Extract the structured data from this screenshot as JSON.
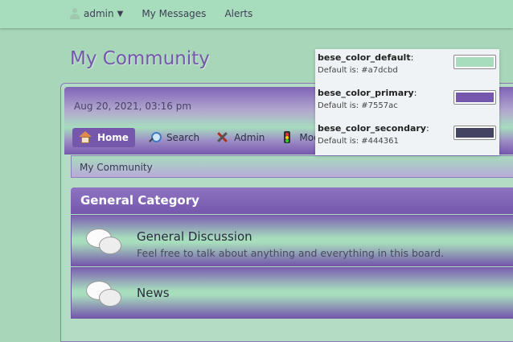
{
  "topbar": {
    "username": "admin",
    "messages": "My Messages",
    "alerts": "Alerts"
  },
  "forum": {
    "title": "My Community",
    "datetime": "Aug 20, 2021, 03:16 pm"
  },
  "menu": {
    "items": [
      {
        "label": "Home",
        "icon": "home-icon"
      },
      {
        "label": "Search",
        "icon": "search-icon"
      },
      {
        "label": "Admin",
        "icon": "admin-tools-icon"
      },
      {
        "label": "Mod",
        "icon": "moderation-icon"
      }
    ]
  },
  "breadcrumb": "My Community",
  "category": {
    "name": "General Category",
    "boards": [
      {
        "name": "General Discussion",
        "description": "Feel free to talk about anything and everything in this board."
      },
      {
        "name": "News",
        "description": ""
      }
    ]
  },
  "popup": {
    "settings": [
      {
        "name": "bese_color_default",
        "default_text": "Default is: #a7dcbd",
        "color": "#a7dcbd"
      },
      {
        "name": "bese_color_primary",
        "default_text": "Default is: #7557ac",
        "color": "#7557ac"
      },
      {
        "name": "bese_color_secondary",
        "default_text": "Default is: #444361",
        "color": "#444361"
      }
    ]
  },
  "colors": {
    "default": "#a7dcbd",
    "primary": "#7557ac",
    "secondary": "#444361"
  }
}
